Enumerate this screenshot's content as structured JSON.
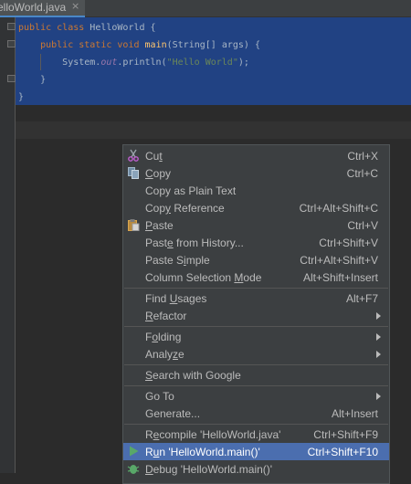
{
  "tab": {
    "title": "elloWorld.java",
    "close": "×"
  },
  "code": {
    "line1": {
      "kw1": "public",
      "kw2": "class",
      "name": "HelloWorld",
      "brace": "{"
    },
    "line2": {
      "kw1": "public",
      "kw2": "static",
      "kw3": "void",
      "fn": "main",
      "params": "(String[] args) {"
    },
    "line3": {
      "cls": "System.",
      "field": "out",
      "call": ".println(",
      "str": "\"Hello World\"",
      "end": ");"
    },
    "line4": "}",
    "line5": "}"
  },
  "menu": {
    "items": [
      {
        "pre": "Cu",
        "mn": "t",
        "post": "",
        "shortcut": "Ctrl+X",
        "icon": "scissors-icon"
      },
      {
        "pre": "",
        "mn": "C",
        "post": "opy",
        "shortcut": "Ctrl+C",
        "icon": "copy-icon"
      },
      {
        "pre": "Copy as Plain Text",
        "mn": "",
        "post": "",
        "shortcut": ""
      },
      {
        "pre": "Cop",
        "mn": "y",
        "post": " Reference",
        "shortcut": "Ctrl+Alt+Shift+C"
      },
      {
        "pre": "",
        "mn": "P",
        "post": "aste",
        "shortcut": "Ctrl+V",
        "icon": "clipboard-icon"
      },
      {
        "pre": "Past",
        "mn": "e",
        "post": " from History...",
        "shortcut": "Ctrl+Shift+V"
      },
      {
        "pre": "Paste S",
        "mn": "i",
        "post": "mple",
        "shortcut": "Ctrl+Alt+Shift+V"
      },
      {
        "pre": "Column Selection ",
        "mn": "M",
        "post": "ode",
        "shortcut": "Alt+Shift+Insert"
      },
      {
        "pre": "Find ",
        "mn": "U",
        "post": "sages",
        "shortcut": "Alt+F7"
      },
      {
        "pre": "",
        "mn": "R",
        "post": "efactor",
        "shortcut": ""
      },
      {
        "pre": "F",
        "mn": "o",
        "post": "lding",
        "shortcut": ""
      },
      {
        "pre": "Analy",
        "mn": "z",
        "post": "e",
        "shortcut": ""
      },
      {
        "pre": "",
        "mn": "S",
        "post": "earch with Google",
        "shortcut": ""
      },
      {
        "pre": "Go To",
        "mn": "",
        "post": "",
        "shortcut": ""
      },
      {
        "pre": "Generate...",
        "mn": "",
        "post": "",
        "shortcut": "Alt+Insert"
      },
      {
        "pre": "R",
        "mn": "e",
        "post": "compile 'HelloWorld.java'",
        "shortcut": "Ctrl+Shift+F9"
      },
      {
        "pre": "R",
        "mn": "u",
        "post": "n 'HelloWorld.main()'",
        "shortcut": "Ctrl+Shift+F10",
        "icon": "run-icon"
      },
      {
        "pre": "",
        "mn": "D",
        "post": "ebug 'HelloWorld.main()'",
        "shortcut": "",
        "icon": "debug-icon"
      }
    ]
  },
  "colors": {
    "selection": "#214283",
    "menu_bg": "#3c3f41",
    "menu_active": "#4b6eaf",
    "keyword": "#cc7832",
    "function": "#ffc66d",
    "string": "#6a8759"
  }
}
